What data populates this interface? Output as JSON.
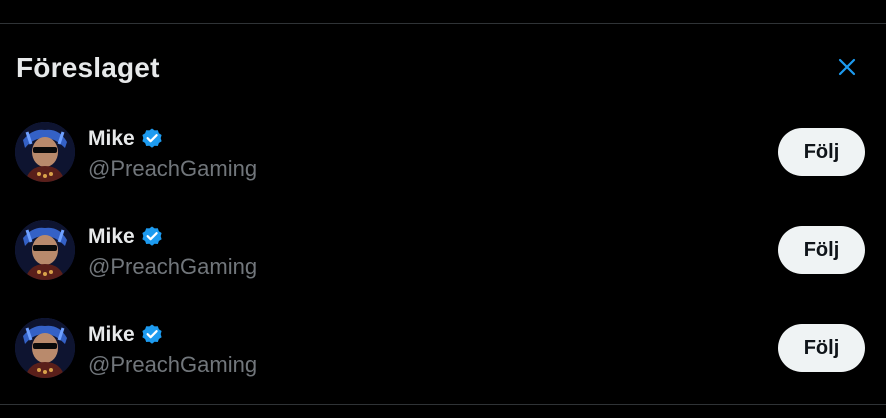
{
  "panel": {
    "title": "Föreslaget",
    "close_icon": "close-icon",
    "accent_color": "#1d9bf0"
  },
  "suggestions": [
    {
      "name": "Mike",
      "handle": "@PreachGaming",
      "verified": true,
      "follow_label": "Följ"
    },
    {
      "name": "Mike",
      "handle": "@PreachGaming",
      "verified": true,
      "follow_label": "Följ"
    },
    {
      "name": "Mike",
      "handle": "@PreachGaming",
      "verified": true,
      "follow_label": "Följ"
    }
  ]
}
